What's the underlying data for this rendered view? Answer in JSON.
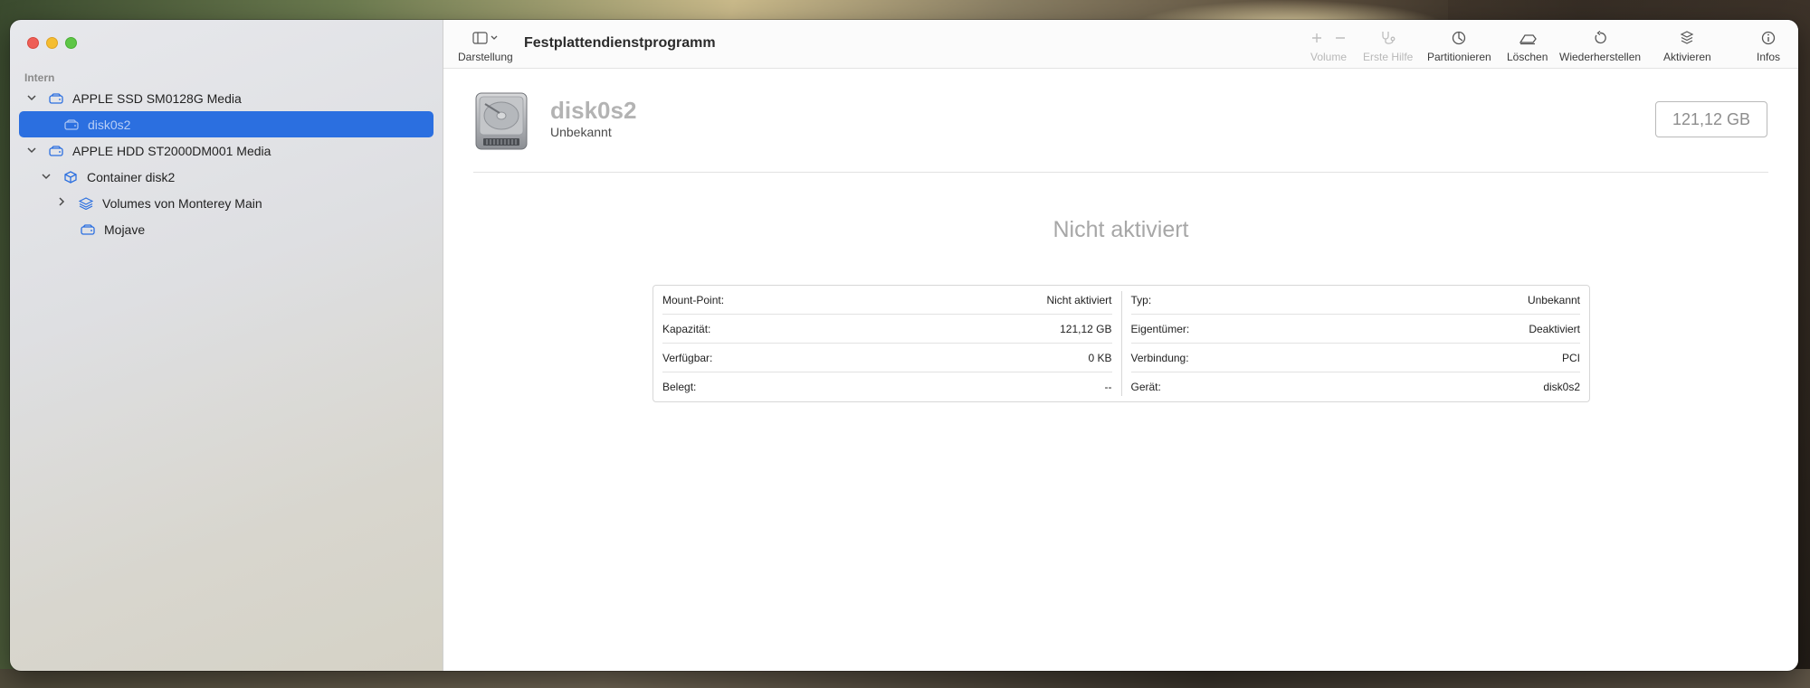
{
  "sidebar": {
    "section": "Intern",
    "items": [
      {
        "label": "APPLE SSD SM0128G Media",
        "icon": "internal-drive-icon"
      },
      {
        "label": "disk0s2",
        "icon": "volume-icon",
        "selected": true
      },
      {
        "label": "APPLE HDD ST2000DM001 Media",
        "icon": "internal-drive-icon"
      },
      {
        "label": "Container disk2",
        "icon": "container-icon"
      },
      {
        "label": "Volumes von Monterey Main",
        "icon": "volume-group-icon"
      },
      {
        "label": "Mojave",
        "icon": "volume-icon"
      }
    ]
  },
  "toolbar": {
    "view_label": "Darstellung",
    "title": "Festplattendienstprogramm",
    "volume_label": "Volume",
    "firstaid_label": "Erste Hilfe",
    "partition_label": "Partitionieren",
    "erase_label": "Löschen",
    "restore_label": "Wiederherstellen",
    "mount_label": "Aktivieren",
    "info_label": "Infos"
  },
  "disk": {
    "name": "disk0s2",
    "subtitle": "Unbekannt",
    "capacity": "121,12 GB",
    "status": "Nicht aktiviert"
  },
  "info": {
    "left": [
      {
        "key": "Mount-Point:",
        "value": "Nicht aktiviert"
      },
      {
        "key": "Kapazität:",
        "value": "121,12 GB"
      },
      {
        "key": "Verfügbar:",
        "value": "0 KB"
      },
      {
        "key": "Belegt:",
        "value": "--"
      }
    ],
    "right": [
      {
        "key": "Typ:",
        "value": "Unbekannt"
      },
      {
        "key": "Eigentümer:",
        "value": "Deaktiviert"
      },
      {
        "key": "Verbindung:",
        "value": "PCI"
      },
      {
        "key": "Gerät:",
        "value": "disk0s2"
      }
    ]
  },
  "colors": {
    "accent": "#2b6fe0",
    "close": "#ee5e56",
    "minimize": "#f5bd30",
    "maximize": "#5ec646"
  }
}
